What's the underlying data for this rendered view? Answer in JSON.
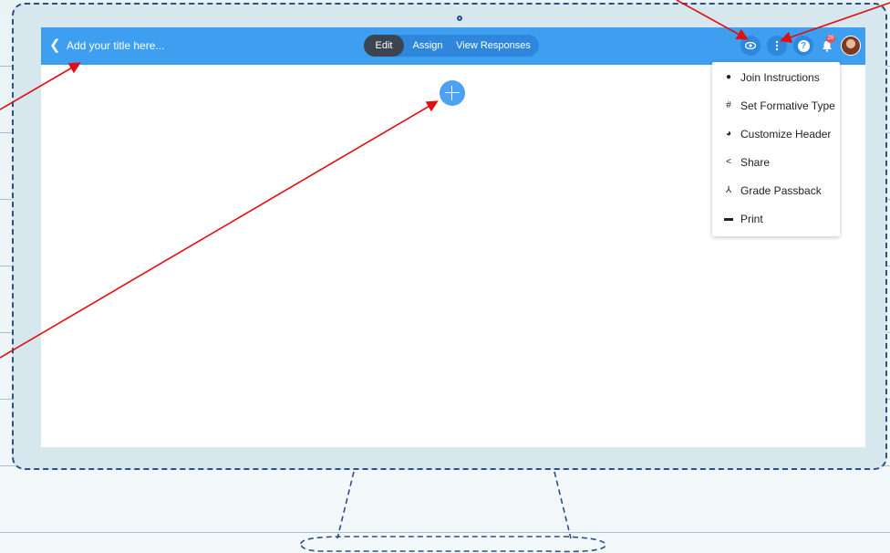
{
  "app": {
    "title_placeholder": "Add your title here...",
    "back_icon": "chevron-left-icon"
  },
  "modes": [
    {
      "label": "Edit",
      "active": true
    },
    {
      "label": "Assign",
      "active": false
    },
    {
      "label": "View Responses",
      "active": false
    }
  ],
  "toolbar": {
    "preview_icon": "eye-icon",
    "more_icon": "kebab-icon",
    "help_icon": "help-icon",
    "help_symbol": "?",
    "notifications_icon": "bell-icon",
    "notifications_count": "28",
    "avatar": "avatar"
  },
  "menu": {
    "items": [
      {
        "label": "Join Instructions",
        "icon": "info-circle-icon",
        "glyph": "●"
      },
      {
        "label": "Set Formative Type",
        "icon": "hash-icon",
        "glyph": "#"
      },
      {
        "label": "Customize Header",
        "icon": "palette-icon",
        "glyph": "◕"
      },
      {
        "label": "Share",
        "icon": "share-icon",
        "glyph": "<"
      },
      {
        "label": "Grade Passback",
        "icon": "sitemap-icon",
        "glyph": "⅄"
      },
      {
        "label": "Print",
        "icon": "print-icon",
        "glyph": "▬"
      }
    ]
  },
  "colors": {
    "topbar": "#3e9ef0",
    "accent": "#4da2f3",
    "annotation_arrow": "#e01010",
    "frame": "#2e4f86"
  }
}
